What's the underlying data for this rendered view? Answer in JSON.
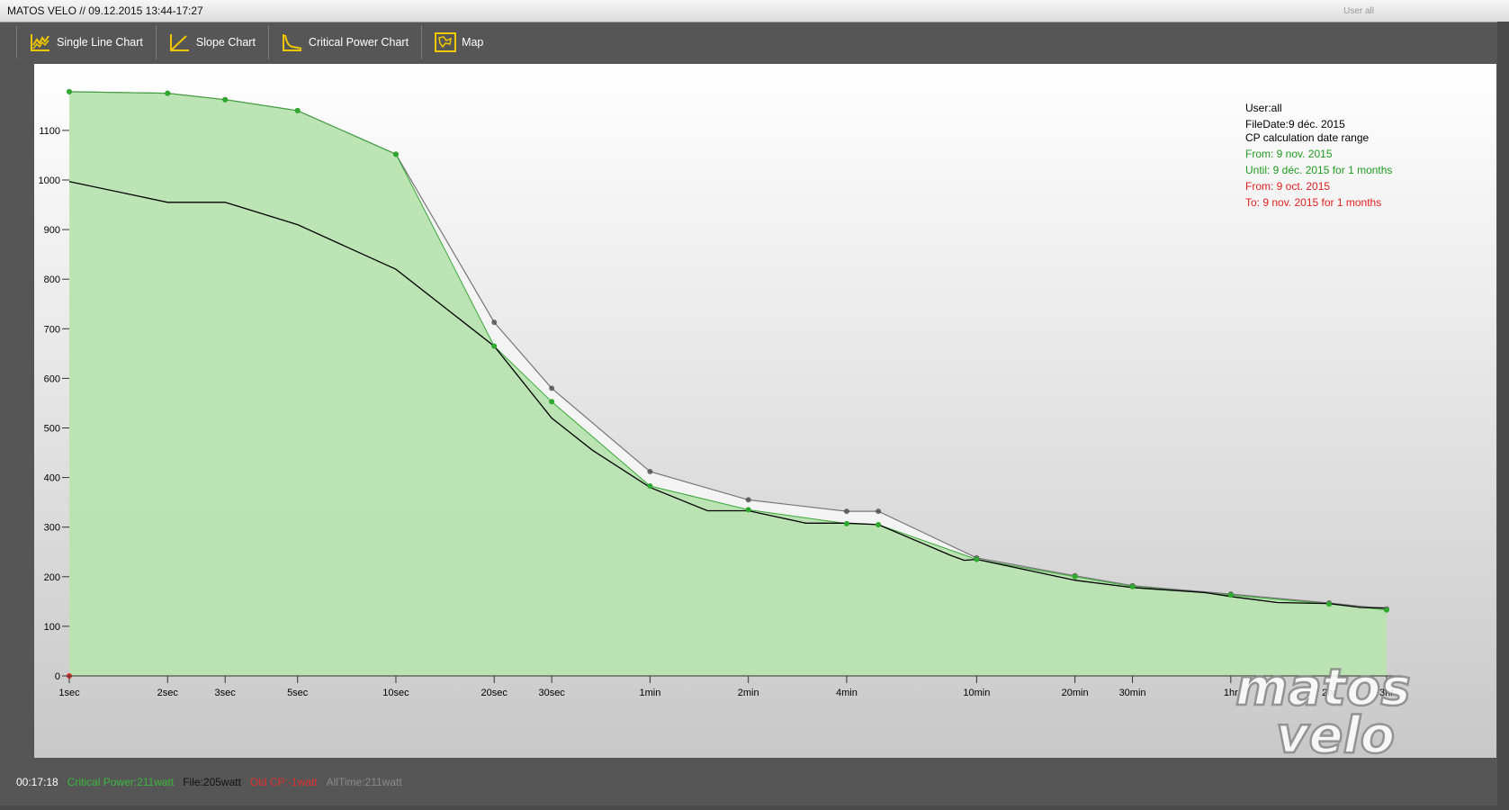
{
  "window": {
    "title": "MATOS VELO // 09.12.2015 13:44-17:27",
    "user_ghost": "User all"
  },
  "toolbar": {
    "buttons": [
      {
        "label": "Single Line Chart",
        "icon": "line-chart-icon"
      },
      {
        "label": "Slope Chart",
        "icon": "slope-chart-icon"
      },
      {
        "label": "Critical Power Chart",
        "icon": "critical-power-chart-icon"
      },
      {
        "label": "Map",
        "icon": "map-icon"
      }
    ],
    "icon_color": "#f0c800"
  },
  "chart_data": {
    "type": "area",
    "x": [
      "1sec",
      "2sec",
      "3sec",
      "5sec",
      "10sec",
      "20sec",
      "30sec",
      "1min",
      "2min",
      "4min",
      "10min",
      "20min",
      "30min",
      "1hr",
      "2hr",
      "3hr"
    ],
    "x_seconds": [
      1,
      2,
      3,
      5,
      10,
      20,
      30,
      60,
      120,
      240,
      600,
      1200,
      1800,
      3600,
      7200,
      10800
    ],
    "x_scale": "log",
    "yticks": [
      0,
      100,
      200,
      300,
      400,
      500,
      600,
      700,
      800,
      900,
      1000,
      1100
    ],
    "ylim": [
      0,
      1200
    ],
    "grid": false,
    "legend_placement": "top-right",
    "series": [
      {
        "name": "Critical Power",
        "color": "#3aa83a",
        "fill": "#b8e3b0",
        "points": [
          [
            1,
            1178
          ],
          [
            2,
            1175
          ],
          [
            3,
            1162
          ],
          [
            5,
            1140
          ],
          [
            10,
            1052
          ],
          [
            20,
            665
          ],
          [
            30,
            553
          ],
          [
            60,
            383
          ],
          [
            120,
            335
          ],
          [
            240,
            307
          ],
          [
            300,
            305
          ],
          [
            600,
            235
          ],
          [
            1200,
            200
          ],
          [
            1800,
            180
          ],
          [
            3600,
            163
          ],
          [
            7200,
            145
          ],
          [
            10800,
            133
          ]
        ]
      },
      {
        "name": "AllTime",
        "color": "#777777",
        "points": [
          [
            1,
            1178
          ],
          [
            2,
            1175
          ],
          [
            3,
            1162
          ],
          [
            5,
            1140
          ],
          [
            10,
            1052
          ],
          [
            20,
            713
          ],
          [
            30,
            580
          ],
          [
            60,
            412
          ],
          [
            120,
            355
          ],
          [
            240,
            332
          ],
          [
            300,
            332
          ],
          [
            600,
            238
          ],
          [
            1200,
            202
          ],
          [
            1800,
            182
          ],
          [
            3600,
            165
          ],
          [
            7200,
            147
          ],
          [
            10800,
            135
          ]
        ]
      },
      {
        "name": "File",
        "color": "#000000",
        "points": [
          [
            1,
            997
          ],
          [
            2,
            955
          ],
          [
            3,
            955
          ],
          [
            5,
            910
          ],
          [
            10,
            820
          ],
          [
            20,
            665
          ],
          [
            30,
            520
          ],
          [
            40,
            455
          ],
          [
            60,
            380
          ],
          [
            90,
            333
          ],
          [
            120,
            333
          ],
          [
            180,
            308
          ],
          [
            240,
            308
          ],
          [
            300,
            305
          ],
          [
            500,
            243
          ],
          [
            550,
            233
          ],
          [
            600,
            235
          ],
          [
            1200,
            193
          ],
          [
            1800,
            178
          ],
          [
            3000,
            168
          ],
          [
            3600,
            160
          ],
          [
            5000,
            148
          ],
          [
            7200,
            146
          ],
          [
            9000,
            138
          ],
          [
            10800,
            137
          ]
        ]
      },
      {
        "name": "Old CP",
        "color": "#e53030",
        "points": [
          [
            1,
            0
          ]
        ]
      }
    ],
    "legend": {
      "user": "User:all",
      "file_date": "FileDate:9 déc. 2015",
      "range_title": "CP calculation date range",
      "from_green": "From: 9 nov. 2015",
      "until_green": "Until: 9 déc. 2015 for 1 months",
      "from_red": "From: 9 oct. 2015",
      "to_red": "To: 9 nov. 2015 for 1 months"
    }
  },
  "status": {
    "time": "00:17:18",
    "critical_power": "Critical Power:211watt",
    "file": "File:205watt",
    "old_cp": "Old CP:-1watt",
    "alltime": "AllTime:211watt",
    "colors": {
      "time": "#ffffff",
      "critical": "#3cb83c",
      "file": "#111111",
      "old": "#e03030",
      "alltime": "#8a8a8a"
    }
  },
  "watermark": {
    "text_top": "matos",
    "text_bottom": "velo"
  }
}
